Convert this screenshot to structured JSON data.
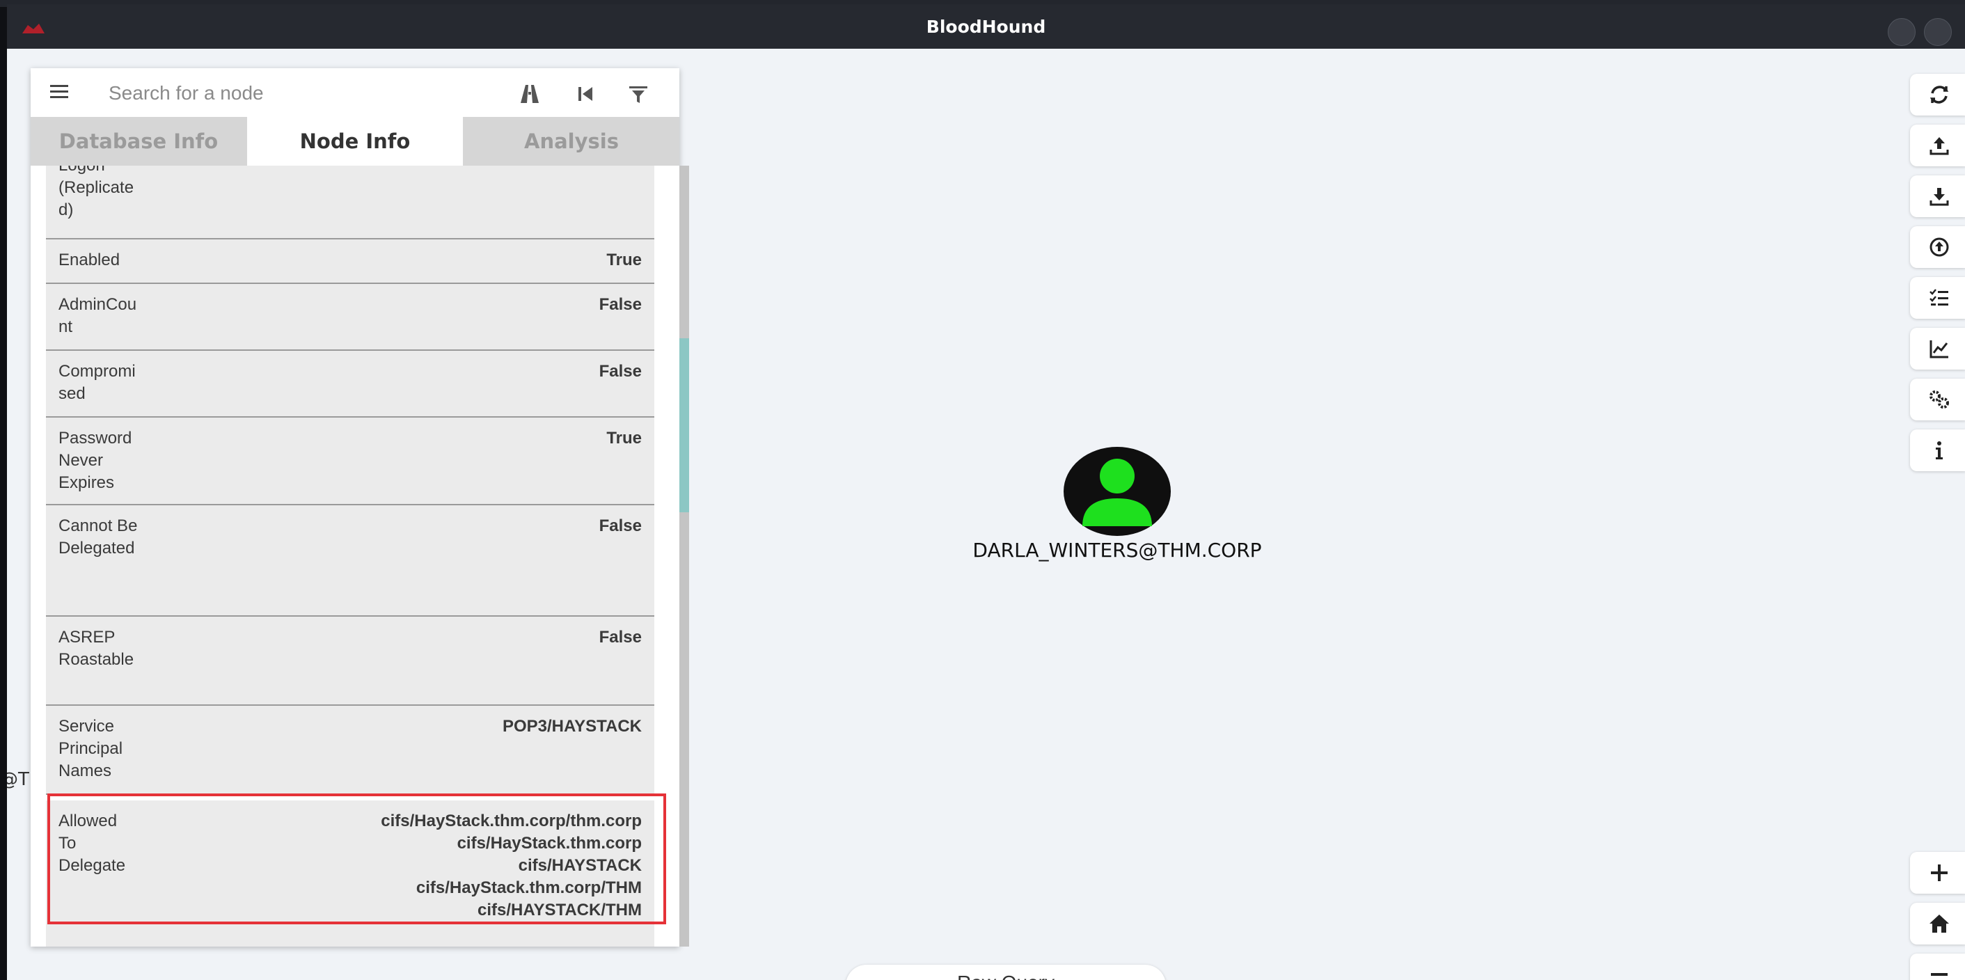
{
  "window": {
    "title": "BloodHound"
  },
  "search": {
    "placeholder": "Search for a node"
  },
  "tabs": [
    {
      "label": "Database Info"
    },
    {
      "label": "Node Info"
    },
    {
      "label": "Analysis"
    }
  ],
  "node_info": {
    "rows": [
      {
        "label": "Logon (Replicated)",
        "value": ""
      },
      {
        "label": "Enabled",
        "value": "True"
      },
      {
        "label": "AdminCount",
        "value": "False"
      },
      {
        "label": "Compromised",
        "value": "False"
      },
      {
        "label": "Password Never Expires",
        "value": "True"
      },
      {
        "label": "Cannot Be Delegated",
        "value": "False"
      },
      {
        "label": "ASREP Roastable",
        "value": "False"
      },
      {
        "label": "Service Principal Names",
        "value": "POP3/HAYSTACK"
      }
    ],
    "allowed_to_delegate": {
      "label": "Allowed To Delegate",
      "values": [
        "cifs/HayStack.thm.corp/thm.corp",
        "cifs/HayStack.thm.corp",
        "cifs/HAYSTACK",
        "cifs/HayStack.thm.corp/THM",
        "cifs/HAYSTACK/THM"
      ]
    }
  },
  "graph": {
    "node_label": "DARLA_WINTERS@THM.CORP",
    "edge_fragment": "@T"
  },
  "bottom": {
    "raw_query_label": "Raw Query"
  },
  "toolbar_icons": [
    "refresh-icon",
    "upload-icon",
    "download-icon",
    "export-icon",
    "query-list-icon",
    "chart-icon",
    "settings-icon",
    "info-icon",
    "zoom-in-icon",
    "home-icon",
    "zoom-out-icon"
  ],
  "colors": {
    "node_icon": "#1ee01e",
    "highlight": "#e53238",
    "scroll_thumb": "#8cc7c4"
  }
}
